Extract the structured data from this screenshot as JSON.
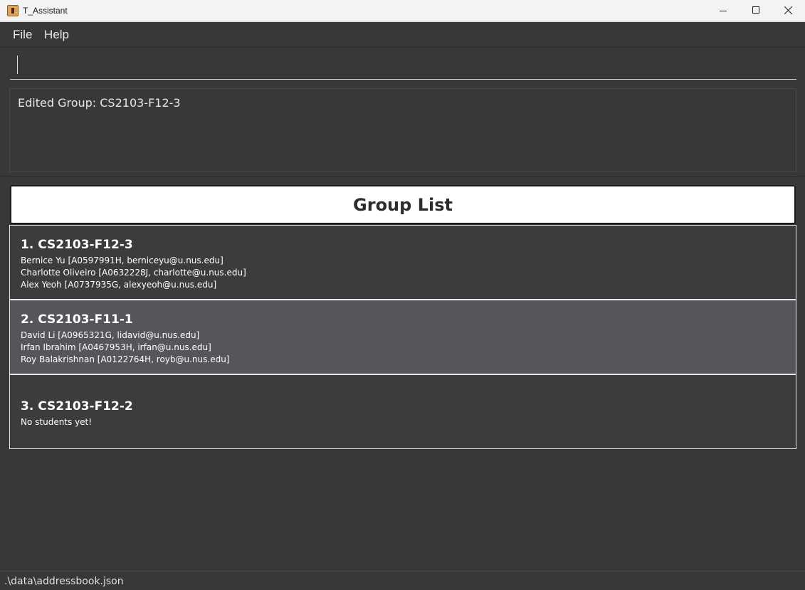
{
  "window": {
    "title": "T_Assistant",
    "icon": "app-icon"
  },
  "menu": {
    "items": [
      {
        "label": "File"
      },
      {
        "label": "Help"
      }
    ]
  },
  "command": {
    "value": "",
    "placeholder": ""
  },
  "result": {
    "text": "Edited Group: CS2103-F12-3"
  },
  "group_list": {
    "title": "Group List",
    "groups": [
      {
        "label": "1. CS2103-F12-3",
        "selected": false,
        "students": [
          "Bernice Yu [A0597991H, berniceyu@u.nus.edu]",
          "Charlotte Oliveiro [A0632228J, charlotte@u.nus.edu]",
          "Alex Yeoh [A0737935G, alexyeoh@u.nus.edu]"
        ]
      },
      {
        "label": "2. CS2103-F11-1",
        "selected": true,
        "students": [
          "David Li [A0965321G, lidavid@u.nus.edu]",
          "Irfan Ibrahim [A0467953H, irfan@u.nus.edu]",
          "Roy Balakrishnan [A0122764H, royb@u.nus.edu]"
        ]
      },
      {
        "label": "3. CS2103-F12-2",
        "selected": false,
        "students": [],
        "empty_text": "No students yet!"
      }
    ]
  },
  "status": {
    "path": ".\\data\\addressbook.json"
  },
  "colors": {
    "background": "#383838",
    "card": "#3b3c3e",
    "card_selected": "#545659",
    "header_bg": "#ffffff"
  }
}
